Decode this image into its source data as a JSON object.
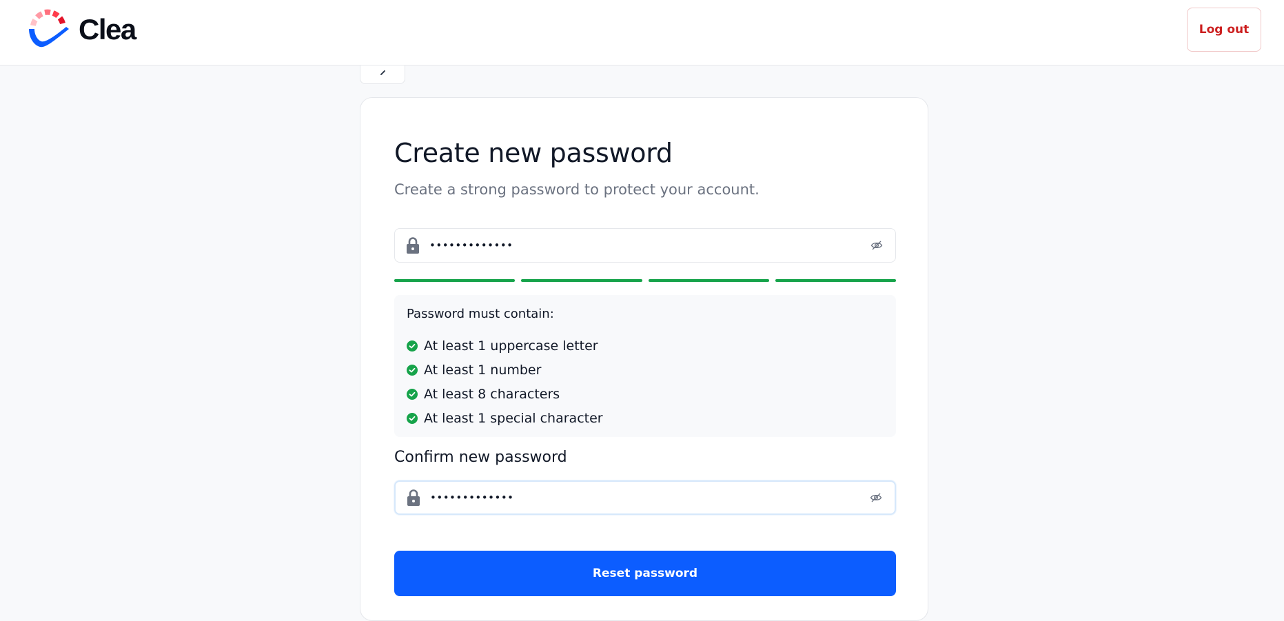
{
  "brand": {
    "name": "Clea",
    "accent": "#0c5dff",
    "danger": "#cc1f1f",
    "success": "#16a34a"
  },
  "header": {
    "logout_label": "Log out"
  },
  "back_button": {
    "icon": "chevron-left-icon"
  },
  "form": {
    "title": "Create new password",
    "subtitle": "Create a strong password to protect your account.",
    "new_password": {
      "value": "•••••••••••••",
      "icon": "lock-icon",
      "toggle_icon": "eye-off-icon"
    },
    "strength": {
      "segments_filled": 4,
      "segments_total": 4,
      "color": "#16a34a"
    },
    "requirements": {
      "title": "Password must contain:",
      "items": [
        {
          "label": "At least 1 uppercase letter",
          "met": true
        },
        {
          "label": "At least 1 number",
          "met": true
        },
        {
          "label": "At least 8 characters",
          "met": true
        },
        {
          "label": "At least 1 special character",
          "met": true
        }
      ]
    },
    "confirm_label": "Confirm new password",
    "confirm_password": {
      "value": "•••••••••••••",
      "icon": "lock-icon",
      "toggle_icon": "eye-off-icon"
    },
    "submit_label": "Reset password"
  }
}
